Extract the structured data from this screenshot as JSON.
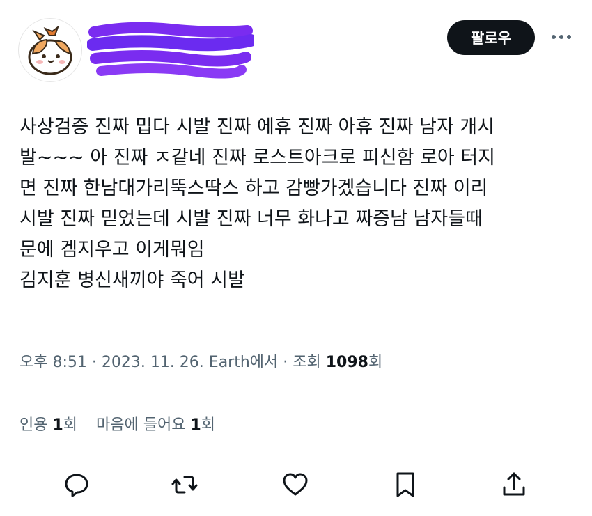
{
  "header": {
    "follow_label": "팔로우"
  },
  "tweet": {
    "lines": [
      "사상검증 진짜 밉다 시발 진짜 에휴 진짜 아휴 진짜 남자 개시",
      "발~~~ 아 진짜 ㅈ같네 진짜 로스트아크로 피신함 로아 터지",
      "면 진짜 한남대가리뚝스딱스 하고 감빵가겠습니다 진짜 이리",
      "시발 진짜 믿었는데 시발 진짜 너무 화나고 짜증남 남자들때",
      "문에 겜지우고 이게뭐임",
      "김지훈 병신새끼야 죽어 시발"
    ]
  },
  "meta": {
    "time_source": "오후 8:51 · 2023. 11. 26. Earth에서 · 조회 ",
    "views": "1098",
    "views_suffix": "회"
  },
  "stats": {
    "quotes_label": "인용 ",
    "quotes": "1",
    "quotes_suffix": "회",
    "likes_label": "마음에 들어요 ",
    "likes": "1",
    "likes_suffix": "회"
  },
  "icons": {
    "actions": [
      "reply-icon",
      "retweet-icon",
      "like-icon",
      "bookmark-icon",
      "share-icon"
    ],
    "more": "more-icon"
  },
  "colors": {
    "text": "#0f1419",
    "secondary": "#536471",
    "follow_bg": "#0f1419",
    "scribble": "#7a2cf0",
    "divider": "#eff3f4"
  }
}
